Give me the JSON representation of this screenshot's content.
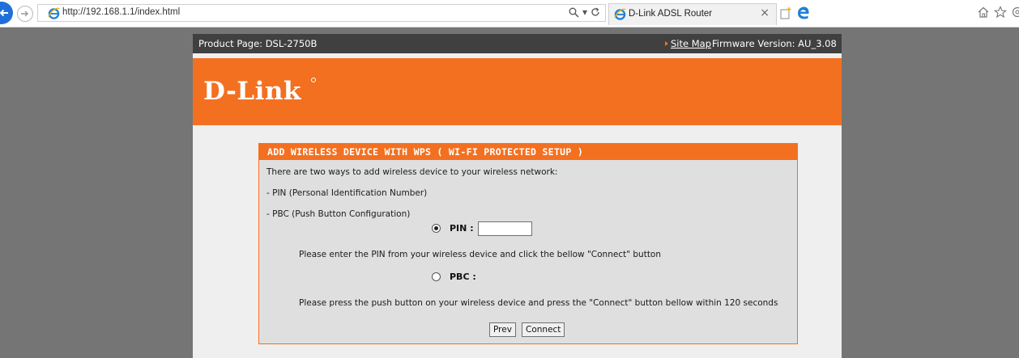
{
  "browser": {
    "url": "http://192.168.1.1/index.html",
    "search_dropdown": "▾",
    "tab_title": "D-Link ADSL Router",
    "tab_close": "×"
  },
  "router": {
    "product_page": "Product Page: DSL-2750B",
    "site_map": "Site Map",
    "firmware": "Firmware Version: AU_3.08",
    "logo": "D-Link"
  },
  "wps": {
    "title": "ADD WIRELESS DEVICE WITH WPS ( WI-FI PROTECTED SETUP )",
    "intro": "There are two ways to add wireless device to your wireless network:",
    "method_pin": "- PIN (Personal Identification Number)",
    "method_pbc": "- PBC (Push Button Configuration)",
    "pin_label": "PIN :",
    "pin_value": "",
    "pin_selected": true,
    "pin_help": "Please enter the PIN from your wireless device and click the bellow \"Connect\" button",
    "pbc_label": "PBC :",
    "pbc_selected": false,
    "pbc_help": "Please press the push button on your wireless device and press the \"Connect\" button bellow within 120 seconds",
    "prev_label": "Prev",
    "connect_label": "Connect"
  },
  "colors": {
    "brand_orange": "#f37021",
    "top_strip": "#404040",
    "page_background": "#757575"
  },
  "icons": [
    "back-icon",
    "forward-icon",
    "ie-icon",
    "search-icon",
    "refresh-icon",
    "new-tab-icon",
    "edge-icon",
    "home-icon",
    "favorites-icon",
    "settings-icon"
  ]
}
